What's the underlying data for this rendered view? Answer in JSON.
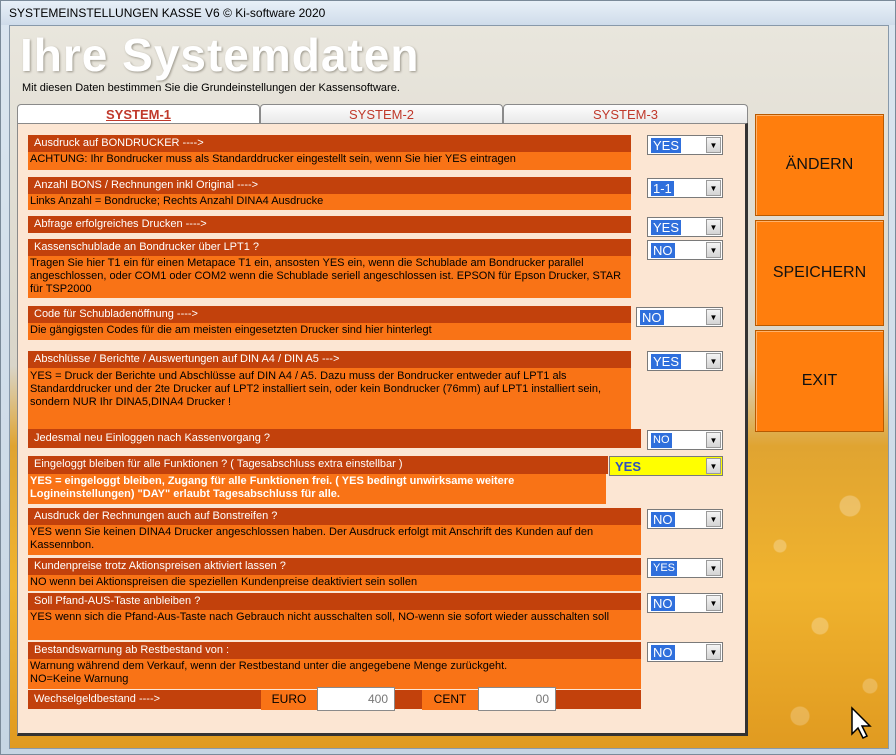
{
  "window": {
    "title": "SYSTEMEINSTELLUNGEN KASSE  V6  © Ki-software 2020"
  },
  "header": {
    "title": "Ihre Systemdaten",
    "subtitle": "Mit diesen Daten bestimmen Sie die Grundeinstellungen der Kassensoftware."
  },
  "tabs": [
    {
      "label": "SYSTEM-1",
      "active": true
    },
    {
      "label": "SYSTEM-2",
      "active": false
    },
    {
      "label": "SYSTEM-3",
      "active": false
    }
  ],
  "settings": [
    {
      "label": "Ausdruck auf BONDRUCKER ---->",
      "desc": "ACHTUNG: Ihr Bondrucker muss als Standarddrucker eingestellt sein, wenn Sie hier YES eintragen",
      "value": "YES"
    },
    {
      "label": "Anzahl BONS / Rechnungen inkl Original ---->",
      "desc": "Links Anzahl = Bondrucke; Rechts Anzahl DINA4 Ausdrucke",
      "value": "1-1"
    },
    {
      "label": "Abfrage erfolgreiches Drucken ---->",
      "desc": "",
      "value": "YES"
    },
    {
      "label": "Kassenschublade an Bondrucker über LPT1 ?",
      "desc": "Tragen Sie hier T1 ein für einen Metapace T1 ein, ansosten YES ein, wenn die Schublade am  Bondrucker parallel angeschlossen, oder COM1 oder COM2 wenn die Schublade seriell angeschlossen ist. EPSON für Epson Drucker, STAR für TSP2000",
      "value": "NO"
    },
    {
      "label": "Code für Schubladenöffnung ---->",
      "desc": "Die gängigsten Codes für die am meisten eingesetzten Drucker sind hier hinterlegt",
      "value": "NO"
    },
    {
      "label": "Abschlüsse / Berichte / Auswertungen auf DIN A4  / DIN A5     --->",
      "desc": "YES = Druck der Berichte und Abschlüsse auf DIN A4 / A5.  Dazu muss der Bondrucker entweder auf LPT1 als Standarddrucker und der 2te Drucker auf LPT2 installiert sein, oder kein Bondrucker (76mm) auf LPT1 installiert sein, sondern NUR Ihr DINA5,DINA4 Drucker  !",
      "value": "YES"
    },
    {
      "label": "Jedesmal neu Einloggen nach Kassenvorgang  ?",
      "desc": "",
      "value": "NO"
    },
    {
      "label": "Eingeloggt bleiben für alle Funktionen ? ( Tagesabschluss extra einstellbar )",
      "desc": "YES = eingeloggt bleiben, Zugang für alle Funktionen frei. ( YES bedingt unwirksame weitere Logineinstellungen) \"DAY\"  erlaubt Tagesabschluss für alle.",
      "value": "YES"
    },
    {
      "label": "Ausdruck der Rechnungen auch auf Bonstreifen ?",
      "desc": "YES wenn Sie keinen DINA4 Drucker angeschlossen haben. Der Ausdruck erfolgt mit Anschrift des Kunden auf den Kassennbon.",
      "value": "NO"
    },
    {
      "label": "Kundenpreise trotz Aktionspreisen  aktiviert lassen ?",
      "desc": "NO wenn bei Aktionspreisen die speziellen Kundenpreise deaktiviert sein sollen",
      "value": "YES"
    },
    {
      "label": "Soll Pfand-AUS-Taste anbleiben ?",
      "desc": "YES wenn sich die Pfand-Aus-Taste nach Gebrauch nicht ausschalten soll, NO-wenn sie sofort wieder ausschalten soll",
      "value": "NO"
    },
    {
      "label": "Bestandswarnung ab Restbestand von :",
      "desc": "Warnung während dem Verkauf, wenn der Restbestand unter die angegebene Menge zurückgeht.\nNO=Keine Warnung",
      "value": "NO"
    }
  ],
  "wechselgeld": {
    "label": "Wechselgeldbestand   ---->",
    "euro_label": "EURO",
    "euro_value": "400",
    "cent_label": "CENT",
    "cent_value": "00"
  },
  "buttons": {
    "aendern": "ÄNDERN",
    "speichern": "SPEICHERN",
    "exit": "EXIT"
  }
}
